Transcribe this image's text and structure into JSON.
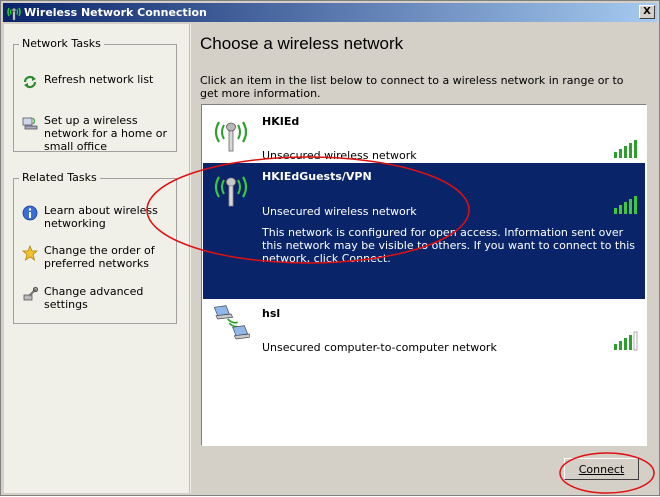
{
  "window": {
    "title": "Wireless Network Connection",
    "close_glyph": "X"
  },
  "sidebar": {
    "network_tasks": {
      "title": "Network Tasks",
      "items": [
        {
          "label": "Refresh network list",
          "icon": "refresh-icon"
        },
        {
          "label": "Set up a wireless network for a home or small office",
          "icon": "setup-wireless-icon"
        }
      ]
    },
    "related_tasks": {
      "title": "Related Tasks",
      "items": [
        {
          "label": "Learn about wireless networking",
          "icon": "info-icon"
        },
        {
          "label": "Change the order of preferred networks",
          "icon": "star-icon"
        },
        {
          "label": "Change advanced settings",
          "icon": "settings-icon"
        }
      ]
    }
  },
  "main": {
    "heading": "Choose a wireless network",
    "intro": "Click an item in the list below to connect to a wireless network in range or to get more information."
  },
  "networks": [
    {
      "name": "HKIEd",
      "status": "Unsecured wireless network",
      "type": "access-point",
      "signal_bars": 5
    },
    {
      "name": "HKIEdGuests/VPN",
      "status": "Unsecured wireless network",
      "description": "This network is configured for open access. Information sent over this network may be visible to others. If you want to connect to this network, click Connect.",
      "type": "access-point",
      "signal_bars": 5,
      "selected": true
    },
    {
      "name": "hsl",
      "status": "Unsecured computer-to-computer network",
      "type": "ad-hoc",
      "signal_bars": 4
    }
  ],
  "buttons": {
    "connect": "Connect"
  },
  "colors": {
    "titlebar": "#0a246a",
    "selection": "#0a246a",
    "signal_green": "#2e9e2e",
    "annotation_red": "#e01010"
  }
}
